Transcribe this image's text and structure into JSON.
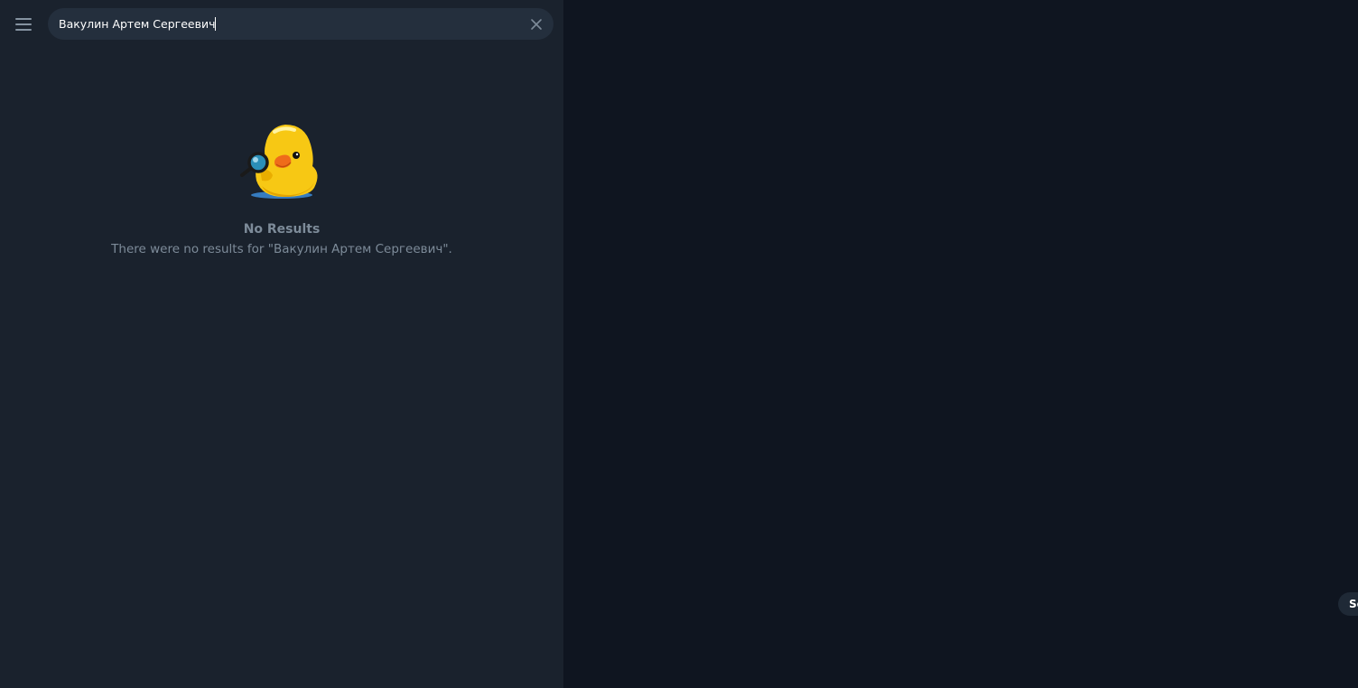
{
  "search": {
    "value": "Вакулин Артем Сергеевич"
  },
  "icons": {
    "menu": "hamburger-menu-icon",
    "clear": "close-icon",
    "illustration": "duck-with-magnifier-icon"
  },
  "empty_state": {
    "title": "No Results",
    "subtitle": "There were no results for \"Вакулин Артем Сергеевич\"."
  },
  "right_pane": {
    "pill_label": "Se"
  },
  "colors": {
    "sidebar_bg": "#1a222d",
    "main_bg": "#0f1520",
    "search_bg": "#242f3d",
    "muted_text": "#7d8b99"
  }
}
